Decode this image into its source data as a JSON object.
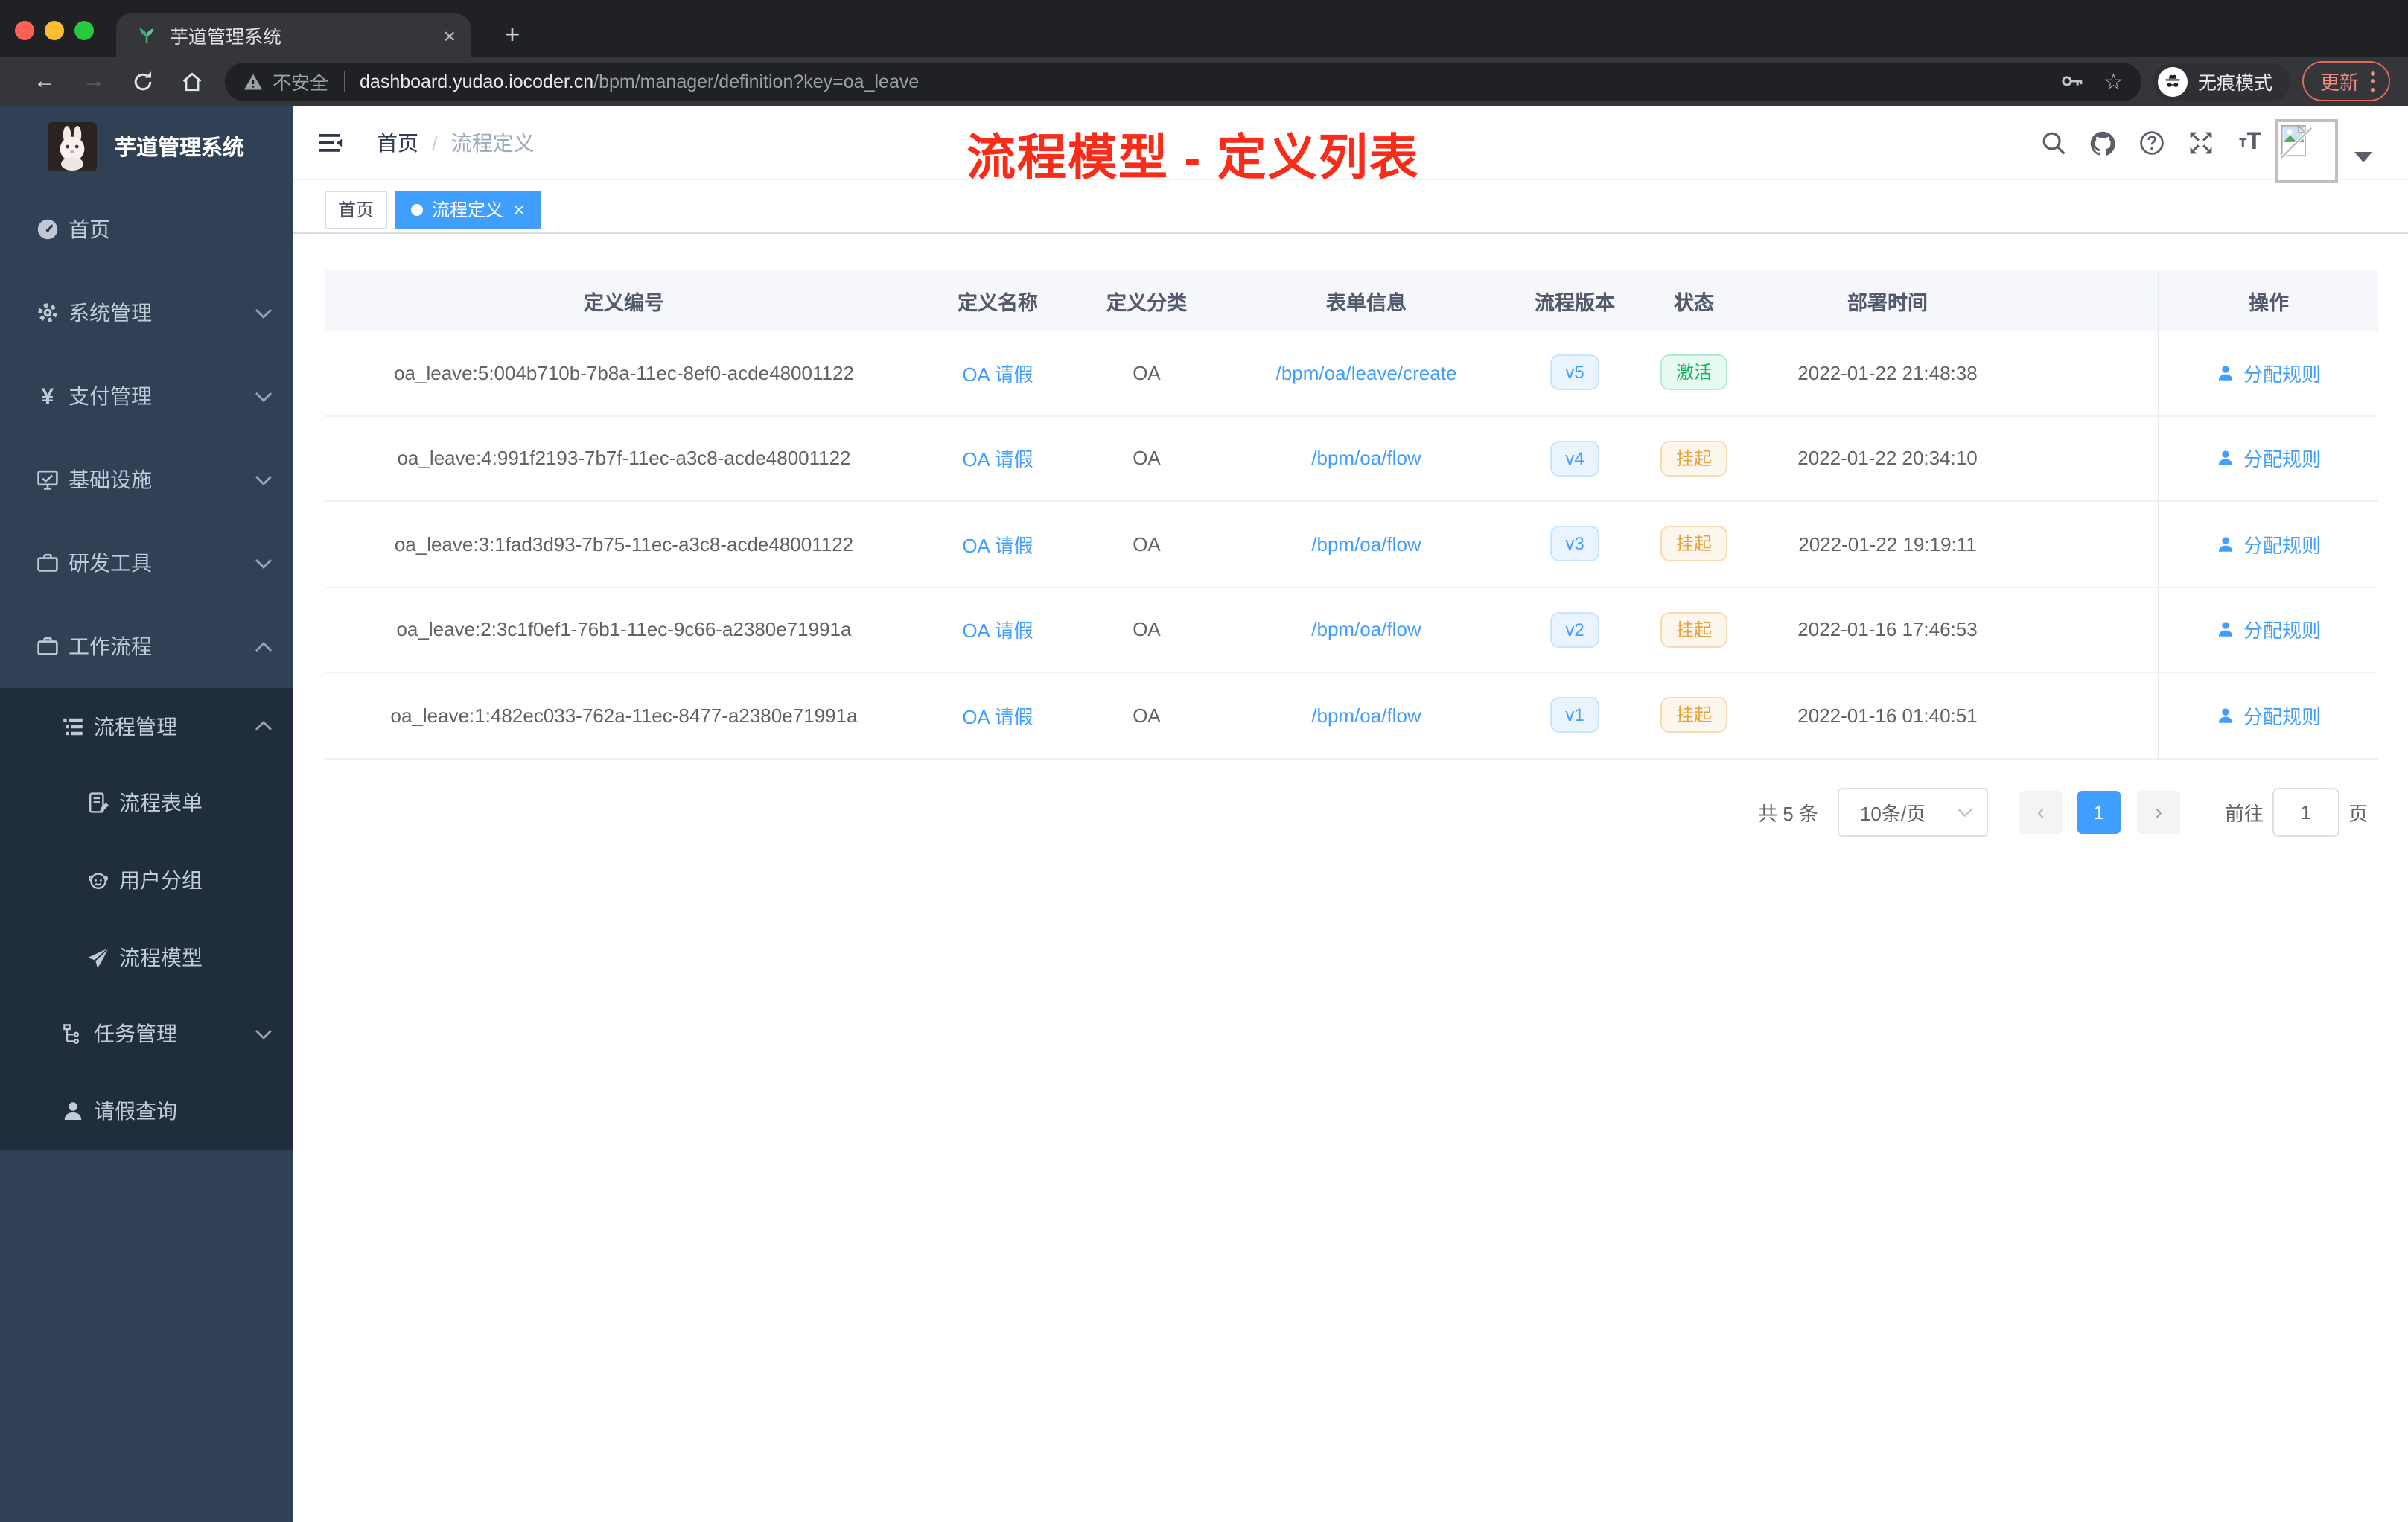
{
  "glyphs": {
    "close_x": "×",
    "plus": "+",
    "slash": "/",
    "star": "☆",
    "prev": "‹",
    "next": "›",
    "font_small": "т",
    "font_big": "T",
    "yen": "¥"
  },
  "colors": {
    "accent": "#409eff",
    "sidebar_bg": "#304156",
    "submenu_bg": "#1f2d3d",
    "annotation_red": "#fa2c19",
    "success_text": "#16b75f",
    "warning_text": "#e6a23c",
    "chrome_bg": "#202124",
    "chrome_surface": "#35363a"
  },
  "browser": {
    "tab_title": "芋道管理系统",
    "security": "不安全",
    "url_host": "dashboard.yudao.iocoder.cn",
    "url_path": "/bpm/manager/definition?key=oa_leave",
    "incognito": "无痕模式",
    "update": "更新"
  },
  "sidebar": {
    "app_title": "芋道管理系统",
    "menu": [
      {
        "label": "首页"
      },
      {
        "label": "系统管理"
      },
      {
        "label": "支付管理"
      },
      {
        "label": "基础设施"
      },
      {
        "label": "研发工具"
      },
      {
        "label": "工作流程"
      }
    ],
    "submenu": [
      {
        "label": "流程管理"
      },
      {
        "label": "流程表单"
      },
      {
        "label": "用户分组"
      },
      {
        "label": "流程模型"
      },
      {
        "label": "任务管理"
      },
      {
        "label": "请假查询"
      }
    ]
  },
  "navbar": {
    "breadcrumb_home": "首页",
    "breadcrumb_current": "流程定义",
    "annotation": "流程模型 - 定义列表"
  },
  "tags": {
    "home": "首页",
    "active": "流程定义"
  },
  "table": {
    "headers": {
      "id": "定义编号",
      "name": "定义名称",
      "category": "定义分类",
      "form": "表单信息",
      "version": "流程版本",
      "status": "状态",
      "time": "部署时间",
      "actions": "操作"
    },
    "rows": [
      {
        "id": "oa_leave:5:004b710b-7b8a-11ec-8ef0-acde48001122",
        "name": "OA 请假",
        "category": "OA",
        "form": "/bpm/oa/leave/create",
        "version": "v5",
        "status": "激活",
        "time": "2022-01-22 21:48:38",
        "action": "分配规则"
      },
      {
        "id": "oa_leave:4:991f2193-7b7f-11ec-a3c8-acde48001122",
        "name": "OA 请假",
        "category": "OA",
        "form": "/bpm/oa/flow",
        "version": "v4",
        "status": "挂起",
        "time": "2022-01-22 20:34:10",
        "action": "分配规则"
      },
      {
        "id": "oa_leave:3:1fad3d93-7b75-11ec-a3c8-acde48001122",
        "name": "OA 请假",
        "category": "OA",
        "form": "/bpm/oa/flow",
        "version": "v3",
        "status": "挂起",
        "time": "2022-01-22 19:19:11",
        "action": "分配规则"
      },
      {
        "id": "oa_leave:2:3c1f0ef1-76b1-11ec-9c66-a2380e71991a",
        "name": "OA 请假",
        "category": "OA",
        "form": "/bpm/oa/flow",
        "version": "v2",
        "status": "挂起",
        "time": "2022-01-16 17:46:53",
        "action": "分配规则"
      },
      {
        "id": "oa_leave:1:482ec033-762a-11ec-8477-a2380e71991a",
        "name": "OA 请假",
        "category": "OA",
        "form": "/bpm/oa/flow",
        "version": "v1",
        "status": "挂起",
        "time": "2022-01-16 01:40:51",
        "action": "分配规则"
      }
    ]
  },
  "pagination": {
    "total": "共 5 条",
    "page_size": "10条/页",
    "page": "1",
    "goto_label": "前往",
    "goto_value": "1",
    "page_unit": "页"
  }
}
